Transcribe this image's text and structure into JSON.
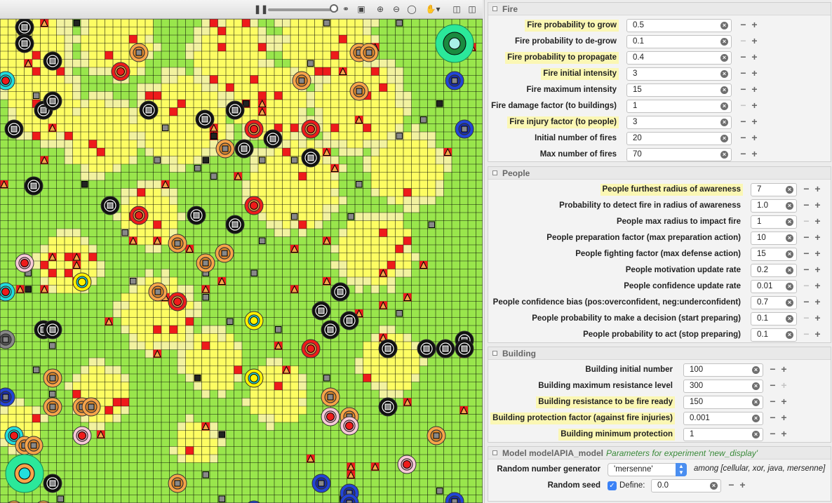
{
  "display": {
    "colors": {
      "grass": "#99e64c",
      "yellow": "#fdfd63",
      "paleYellow": "#f2f2a0",
      "red": "#ee1b1b",
      "orange": "#f7a44a",
      "black": "#111111",
      "cyan": "#21dede",
      "blue": "#2245d8",
      "pink": "#f8c9d8",
      "gray": "#888888"
    },
    "toolbar_icons": [
      "pause-icon",
      "zoom-slider",
      "link-icon",
      "camera-icon",
      "zoom-in-icon",
      "zoom-out-icon",
      "zoom-fit-icon",
      "hand-icon",
      "layout-icon",
      "split-icon"
    ]
  },
  "fire": {
    "title": "Fire",
    "params": [
      {
        "label": "Fire probability to grow",
        "value": "0.5",
        "highlight": true
      },
      {
        "label": "Fire probability to de-grow",
        "value": "0.1",
        "highlight": false
      },
      {
        "label": "Fire probability to propagate",
        "value": "0.4",
        "highlight": true
      },
      {
        "label": "Fire initial intensity",
        "value": "3",
        "highlight": true
      },
      {
        "label": "Fire maximum intensity",
        "value": "15",
        "highlight": false
      },
      {
        "label": "Fire damage factor (to buildings)",
        "value": "1",
        "highlight": false
      },
      {
        "label": "Fire injury factor (to people)",
        "value": "3",
        "highlight": true
      },
      {
        "label": "Initial number of fires",
        "value": "20",
        "highlight": false
      },
      {
        "label": "Max number of fires",
        "value": "70",
        "highlight": false
      }
    ]
  },
  "people": {
    "title": "People",
    "params": [
      {
        "label": "People furthest radius of awareness",
        "value": "7",
        "highlight": true
      },
      {
        "label": "Probability to detect fire in radius of awareness",
        "value": "1.0",
        "highlight": false
      },
      {
        "label": "People max radius to impact fire",
        "value": "1",
        "highlight": false
      },
      {
        "label": "People preparation factor (max preparation action)",
        "value": "10",
        "highlight": false
      },
      {
        "label": "People fighting factor (max defense action)",
        "value": "15",
        "highlight": false
      },
      {
        "label": "People motivation update rate",
        "value": "0.2",
        "highlight": false
      },
      {
        "label": "People confidence update rate",
        "value": "0.01",
        "highlight": false
      },
      {
        "label": "People confidence bias (pos:overconfident, neg:underconfident)",
        "value": "0.7",
        "highlight": false
      },
      {
        "label": "People probability to make a decision (start preparing)",
        "value": "0.1",
        "highlight": false
      },
      {
        "label": "People probability to act (stop preparing)",
        "value": "0.1",
        "highlight": false
      }
    ]
  },
  "building": {
    "title": "Building",
    "params": [
      {
        "label": "Building initial number",
        "value": "100",
        "highlight": false
      },
      {
        "label": "Building maximum resistance level",
        "value": "300",
        "highlight": false
      },
      {
        "label": "Building resistance to be fire ready",
        "value": "150",
        "highlight": true
      },
      {
        "label": "Building protection factor (against fire injuries)",
        "value": "0.001",
        "highlight": true
      },
      {
        "label": "Building minimum protection",
        "value": "1",
        "highlight": true
      }
    ]
  },
  "model": {
    "title": "Model modelAPIA_model",
    "experiment": "Parameters for experiment 'new_display'",
    "rng_label": "Random number generator",
    "rng_value": "'mersenne'",
    "rng_among": "among [cellular, xor, java, mersenne]",
    "seed_label": "Random seed",
    "seed_define": "Define:",
    "seed_value": "0.0"
  }
}
